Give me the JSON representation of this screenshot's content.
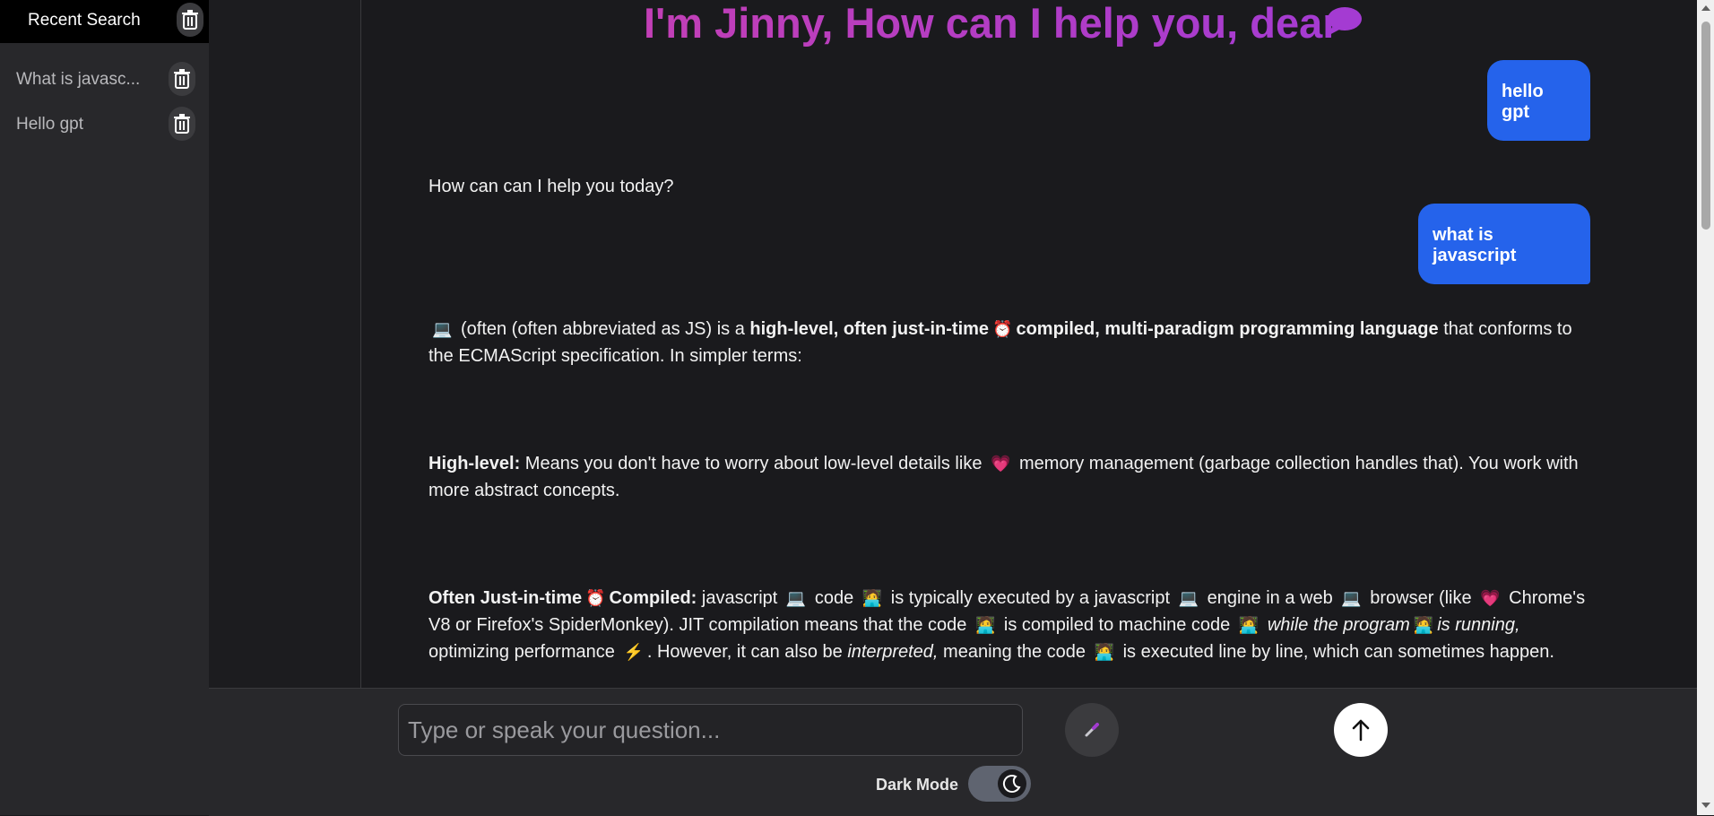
{
  "sidebar": {
    "title": "Recent Search",
    "items": [
      {
        "label": "What is javasc..."
      },
      {
        "label": "Hello gpt"
      }
    ]
  },
  "chat": {
    "headline": "I'm Jinny, How can I help you, dear",
    "headline_icon": "chat-bubble-icon",
    "messages": [
      {
        "role": "user",
        "text": "hello gpt"
      },
      {
        "role": "assistant",
        "text": "How can can I help you today?"
      },
      {
        "role": "user",
        "text": "what is javascript"
      }
    ],
    "answer": {
      "p1": {
        "emoji1": "💻",
        "t1": " (often (often abbreviated as JS) is a ",
        "b1": "high-level, often just-in-time",
        "emoji2": "⏰",
        "b2": "compiled, multi-paradigm programming language",
        "t2": " that conforms to the ECMAScript specification. In simpler terms:"
      },
      "p2": {
        "b1": "High-level:",
        "t1": " Means you don't have to worry about low-level details like ",
        "emoji1": "💗",
        "t2": " memory management (garbage collection handles that). You work with more abstract concepts."
      },
      "p3": {
        "b1": "Often Just-in-time",
        "emoji1": "⏰",
        "b2": "Compiled:",
        "t1": " javascript ",
        "e_laptop": "💻",
        "t2": " code ",
        "e_coder": "🧑‍💻",
        "t3": " is typically executed by a javascript ",
        "t4": " engine in a web ",
        "t5": " browser (like ",
        "e_heart": "💗",
        "t6": " Chrome's V8 or Firefox's SpiderMonkey). JIT compilation means that the code ",
        "t7": " is compiled to machine code ",
        "i1": "while the program",
        "i2": "is running,",
        "t8": " optimizing performance ",
        "e_bolt": "⚡",
        "t9": ". However, it can also be ",
        "i3": "interpreted,",
        "t10": " meaning the code ",
        "t11": " is executed line by line, which can sometimes happen."
      }
    }
  },
  "input": {
    "placeholder": "Type or speak your question...",
    "value": ""
  },
  "controls": {
    "mic_icon": "microphone-icon",
    "send_icon": "arrow-up-icon",
    "dark_mode_label": "Dark Mode",
    "dark_mode_on": true
  },
  "colors": {
    "accent_user_bubble": "#2563eb",
    "headline_gradient_start": "#c23fb6",
    "headline_gradient_end": "#a43bd2"
  }
}
